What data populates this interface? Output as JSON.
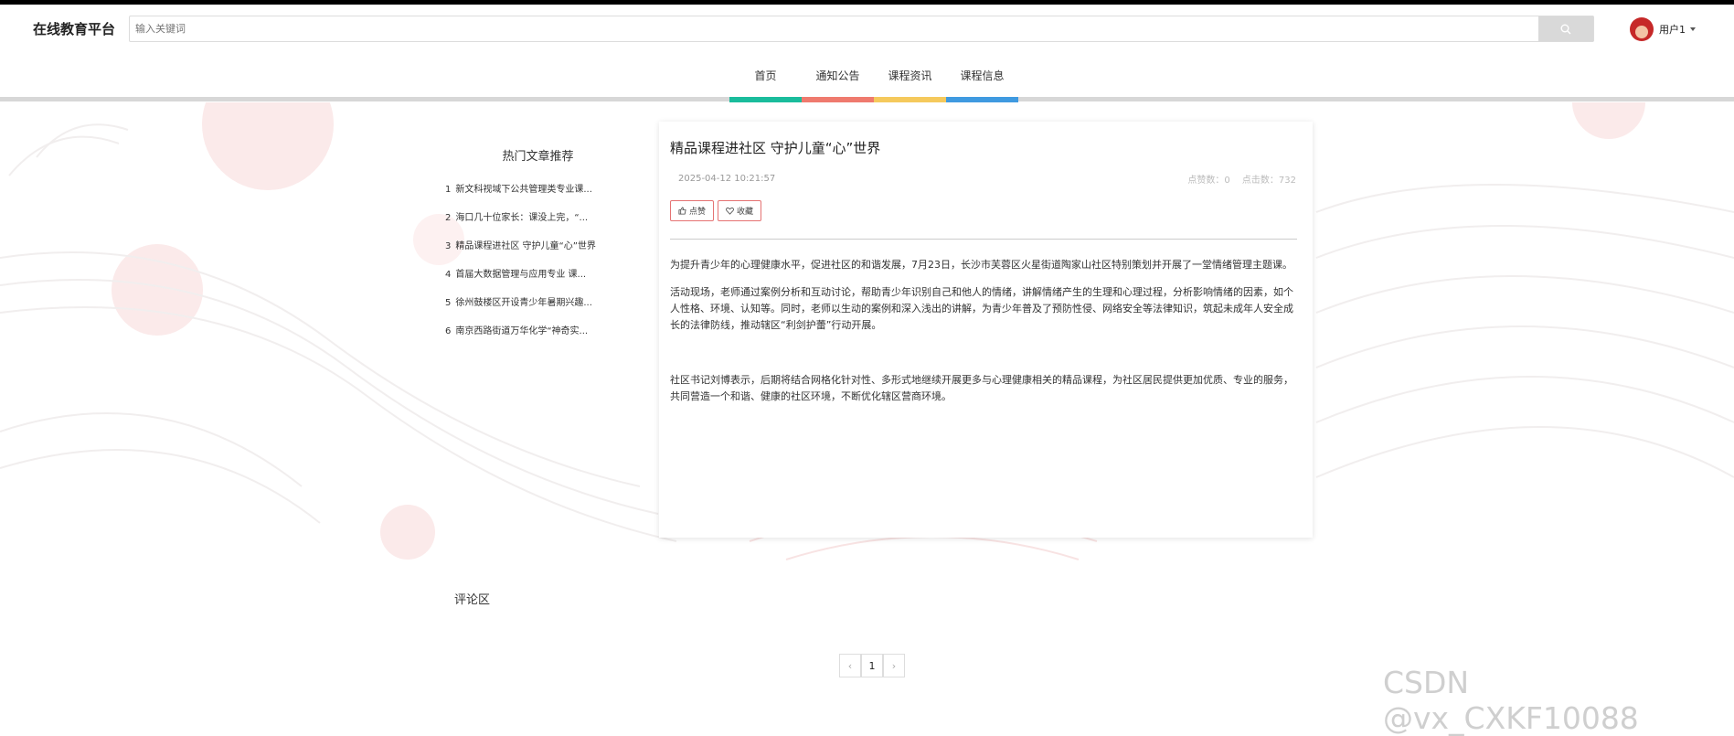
{
  "header": {
    "logo": "在线教育平台",
    "search_placeholder": "输入关键词",
    "username": "用户1"
  },
  "nav": {
    "items": [
      "首页",
      "通知公告",
      "课程资讯",
      "课程信息"
    ],
    "bar_colors": [
      "#1abc9c",
      "#ef7a6e",
      "#f5c95c",
      "#3f9ae0"
    ]
  },
  "hot": {
    "title": "热门文章推荐",
    "items": [
      {
        "idx": "1",
        "text": "新文科视域下公共管理类专业课..."
      },
      {
        "idx": "2",
        "text": "海口几十位家长：课没上完，“..."
      },
      {
        "idx": "3",
        "text": "精品课程进社区 守护儿童“心”世界"
      },
      {
        "idx": "4",
        "text": "首届大数据管理与应用专业 课..."
      },
      {
        "idx": "5",
        "text": "徐州鼓楼区开设青少年暑期兴趣..."
      },
      {
        "idx": "6",
        "text": "南京西路街道万华化学“神奇实..."
      }
    ]
  },
  "article": {
    "title": "精品课程进社区 守护儿童“心”世界",
    "date": "2025-04-12 10:21:57",
    "likes": "点赞数：0",
    "clicks": "点击数：732",
    "like_btn": "点赞",
    "fav_btn": "收藏",
    "paragraphs": [
      "为提升青少年的心理健康水平，促进社区的和谐发展，7月23日，长沙市芙蓉区火星街道陶家山社区特别策划并开展了一堂情绪管理主题课。",
      "活动现场，老师通过案例分析和互动讨论，帮助青少年识别自己和他人的情绪，讲解情绪产生的生理和心理过程，分析影响情绪的因素，如个人性格、环境、认知等。同时，老师以生动的案例和深入浅出的讲解，为青少年普及了预防性侵、网络安全等法律知识，筑起未成年人安全成长的法律防线，推动辖区“利剑护蕾”行动开展。",
      "社区书记刘博表示，后期将结合网格化针对性、多形式地继续开展更多与心理健康相关的精品课程，为社区居民提供更加优质、专业的服务，共同营造一个和谐、健康的社区环境，不断优化辖区营商环境。"
    ]
  },
  "comments": {
    "label": "评论区"
  },
  "pagination": {
    "prev": "‹",
    "current": "1",
    "next": "›"
  },
  "watermark": "CSDN @vx_CXKF10088"
}
